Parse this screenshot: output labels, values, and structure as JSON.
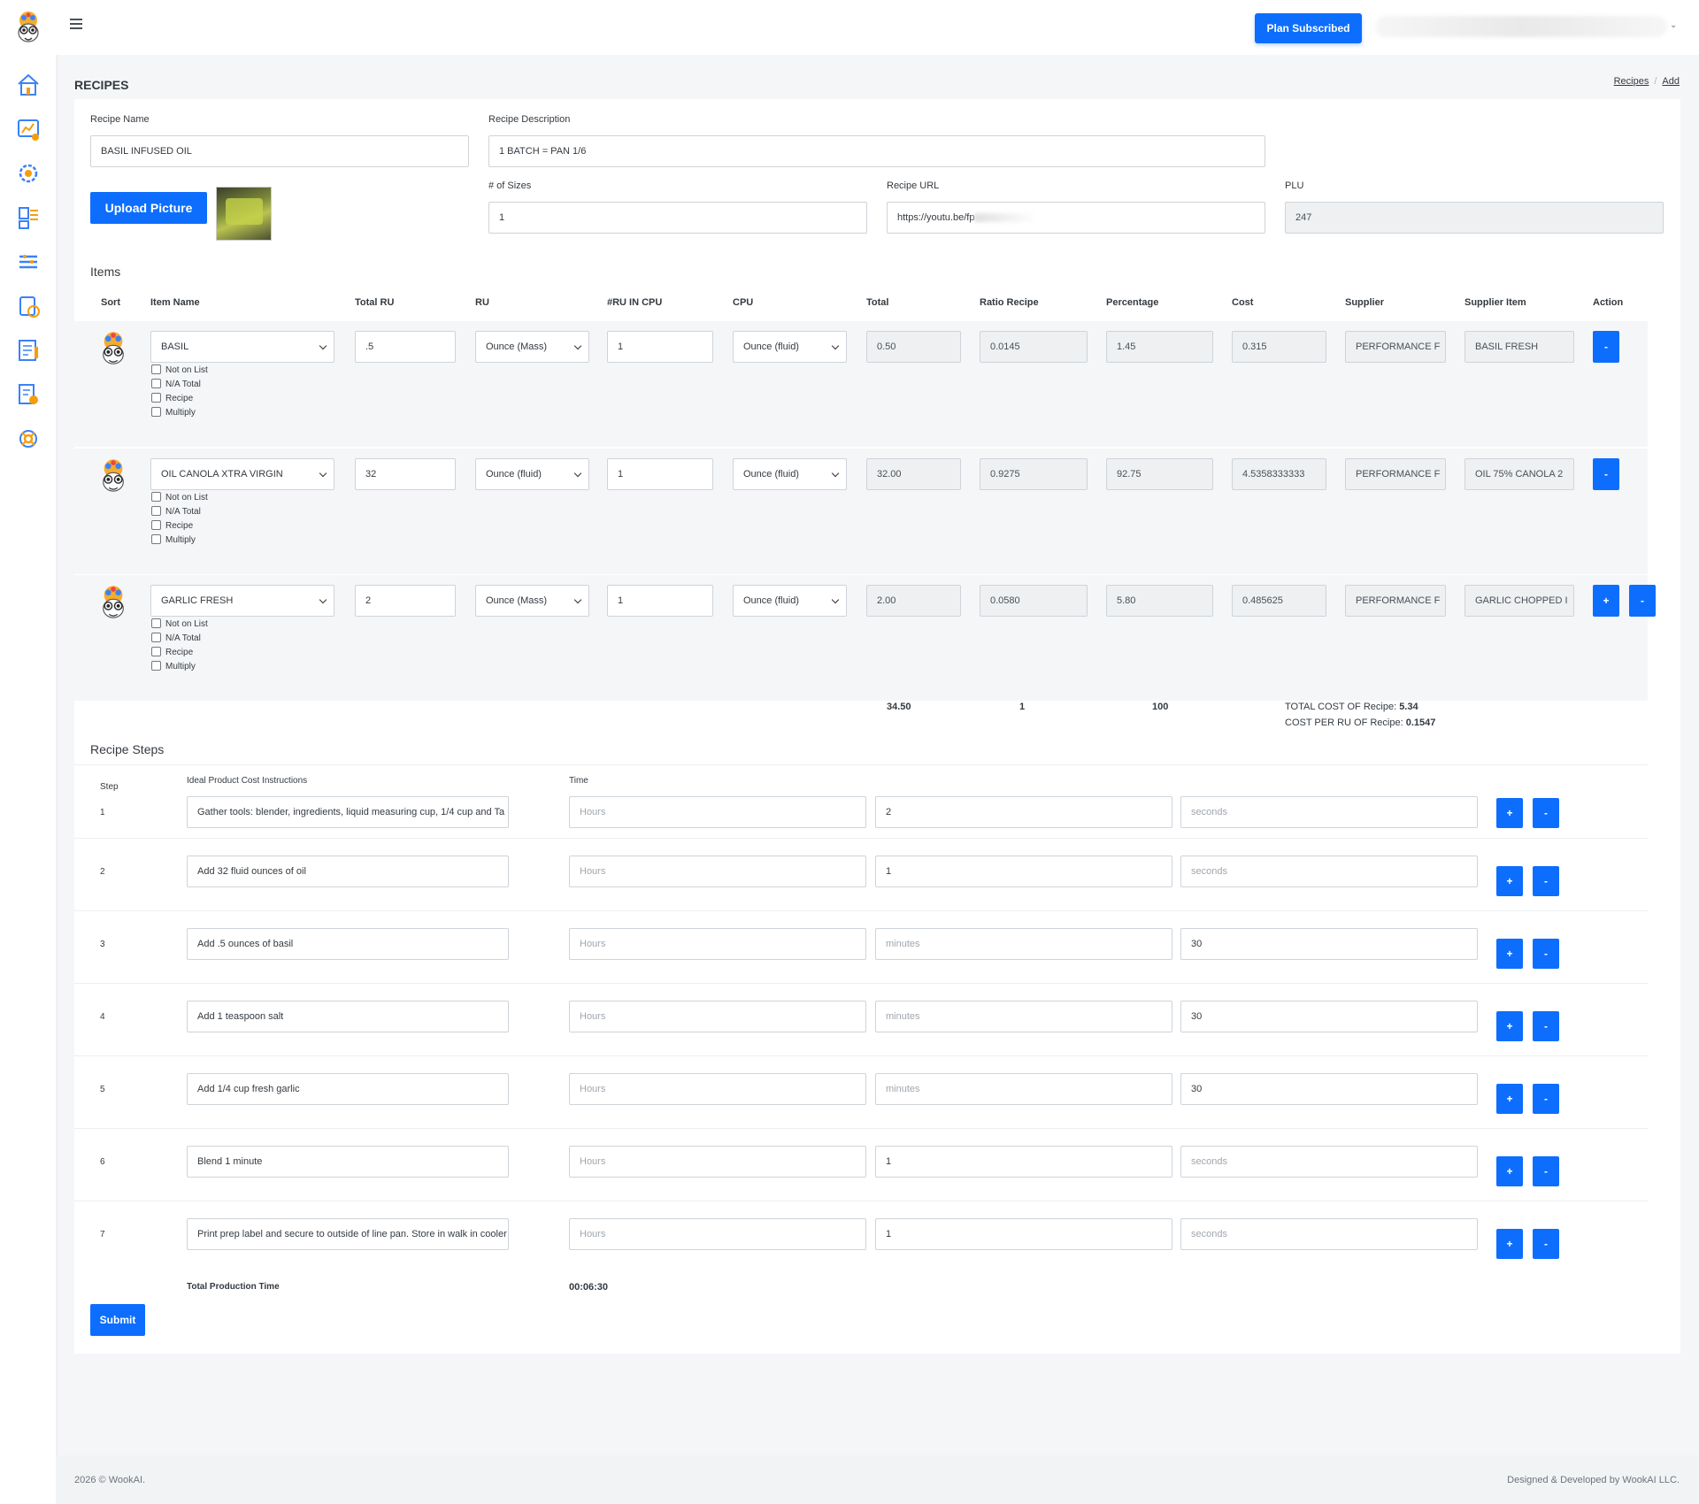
{
  "header": {
    "plan_button": "Plan Subscribed"
  },
  "page": {
    "title": "RECIPES",
    "breadcrumb": [
      "Recipes",
      "Add"
    ]
  },
  "form": {
    "recipe_name_label": "Recipe Name",
    "recipe_name": "BASIL INFUSED OIL",
    "recipe_description_label": "Recipe Description",
    "recipe_description": "1 BATCH = PAN 1/6",
    "upload_button": "Upload Picture",
    "sizes_label": "# of Sizes",
    "sizes": "1",
    "recipe_url_label": "Recipe URL",
    "recipe_url": "https://youtu.be/fp",
    "plu_label": "PLU",
    "plu": "247"
  },
  "items": {
    "section_title": "Items",
    "headers": {
      "sort": "Sort",
      "item_name": "Item Name",
      "total_ru": "Total RU",
      "ru": "RU",
      "ru_in_cpu": "#RU IN CPU",
      "cpu": "CPU",
      "total": "Total",
      "ratio": "Ratio Recipe",
      "percentage": "Percentage",
      "cost": "Cost",
      "supplier": "Supplier",
      "supplier_item": "Supplier Item",
      "action": "Action"
    },
    "checkbox_labels": [
      "Not on List",
      "N/A Total",
      "Recipe",
      "Multiply"
    ],
    "rows": [
      {
        "name": "BASIL",
        "total_ru": ".5",
        "ru": "Ounce (Mass)",
        "ru_in_cpu": "1",
        "cpu": "Ounce (fluid)",
        "total": "0.50",
        "ratio": "0.0145",
        "percentage": "1.45",
        "cost": "0.315",
        "supplier": "PERFORMANCE F",
        "supplier_item": "BASIL FRESH"
      },
      {
        "name": "OIL CANOLA XTRA VIRGIN",
        "total_ru": "32",
        "ru": "Ounce (fluid)",
        "ru_in_cpu": "1",
        "cpu": "Ounce (fluid)",
        "total": "32.00",
        "ratio": "0.9275",
        "percentage": "92.75",
        "cost": "4.5358333333",
        "supplier": "PERFORMANCE F",
        "supplier_item": "OIL 75% CANOLA 2"
      },
      {
        "name": "GARLIC FRESH",
        "total_ru": "2",
        "ru": "Ounce (Mass)",
        "ru_in_cpu": "1",
        "cpu": "Ounce (fluid)",
        "total": "2.00",
        "ratio": "0.0580",
        "percentage": "5.80",
        "cost": "0.485625",
        "supplier": "PERFORMANCE F",
        "supplier_item": "GARLIC CHOPPED I"
      }
    ],
    "totals": {
      "total": "34.50",
      "ratio": "1",
      "percentage": "100",
      "total_cost_label": "TOTAL COST OF Recipe:",
      "total_cost": "5.34",
      "cost_per_ru_label": "COST PER RU OF Recipe:",
      "cost_per_ru": "0.1547"
    }
  },
  "steps": {
    "section_title": "Recipe Steps",
    "headers": {
      "step": "Step",
      "instructions": "Ideal Product Cost Instructions",
      "time": "Time"
    },
    "placeholders": {
      "hours": "Hours",
      "minutes": "minutes",
      "seconds": "seconds"
    },
    "rows": [
      {
        "num": "1",
        "text": "Gather tools: blender, ingredients, liquid measuring cup, 1/4 cup and Ta",
        "minutes": "2",
        "seconds": ""
      },
      {
        "num": "2",
        "text": "Add 32 fluid ounces of oil",
        "minutes": "1",
        "seconds": ""
      },
      {
        "num": "3",
        "text": "Add .5 ounces of basil",
        "minutes": "",
        "seconds": "30"
      },
      {
        "num": "4",
        "text": "Add 1 teaspoon salt",
        "minutes": "",
        "seconds": "30"
      },
      {
        "num": "5",
        "text": "Add 1/4 cup fresh garlic",
        "minutes": "",
        "seconds": "30"
      },
      {
        "num": "6",
        "text": "Blend 1 minute",
        "minutes": "1",
        "seconds": ""
      },
      {
        "num": "7",
        "text": "Print prep label and secure to outside of line pan. Store in walk in cooler",
        "minutes": "1",
        "seconds": ""
      }
    ],
    "total_label": "Total Production Time",
    "total_time": "00:06:30",
    "submit": "Submit"
  },
  "footer": {
    "left": "2026 © WookAI.",
    "right": "Designed & Developed by WookAI LLC."
  },
  "colors": {
    "primary": "#0d6efd",
    "icon_blue": "#3b82f6",
    "icon_orange": "#f59e0b"
  }
}
